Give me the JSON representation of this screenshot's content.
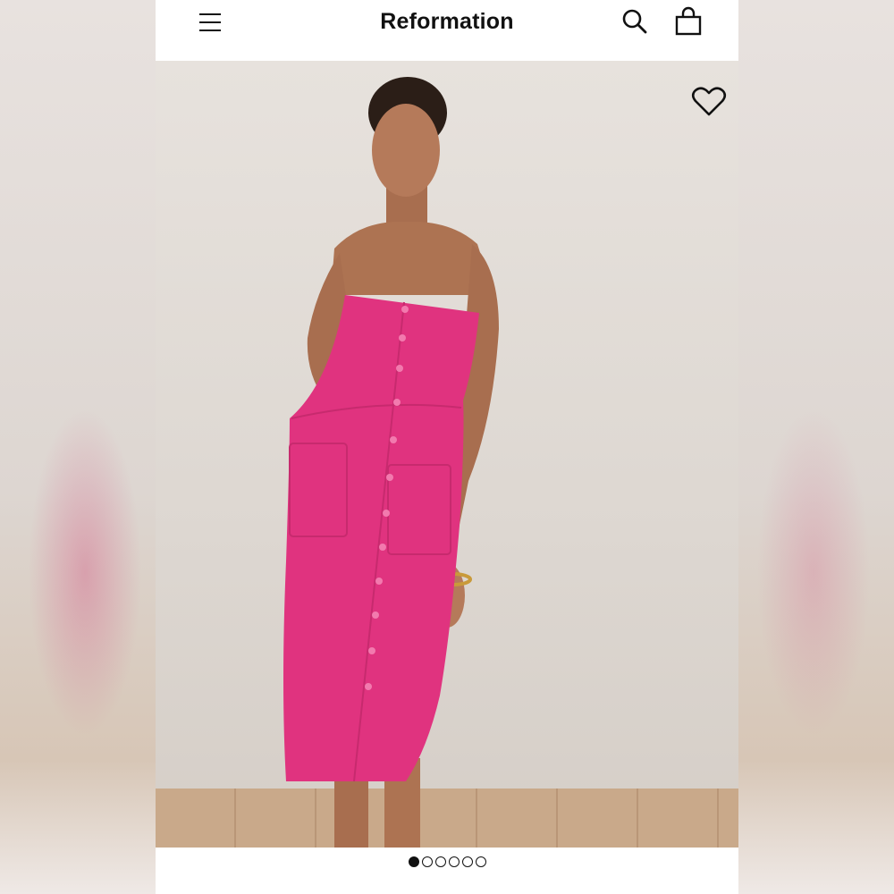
{
  "header": {
    "brand": "Reformation",
    "icons": {
      "menu": "menu-icon",
      "search": "search-icon",
      "bag": "shopping-bag-icon"
    }
  },
  "product_image": {
    "favorite_icon": "heart-outline-icon",
    "dress_color": "#e0337f",
    "carousel": {
      "total": 6,
      "active_index": 0
    }
  },
  "colors": {
    "text": "#111111",
    "background": "#ffffff",
    "dress": "#e0337f"
  }
}
